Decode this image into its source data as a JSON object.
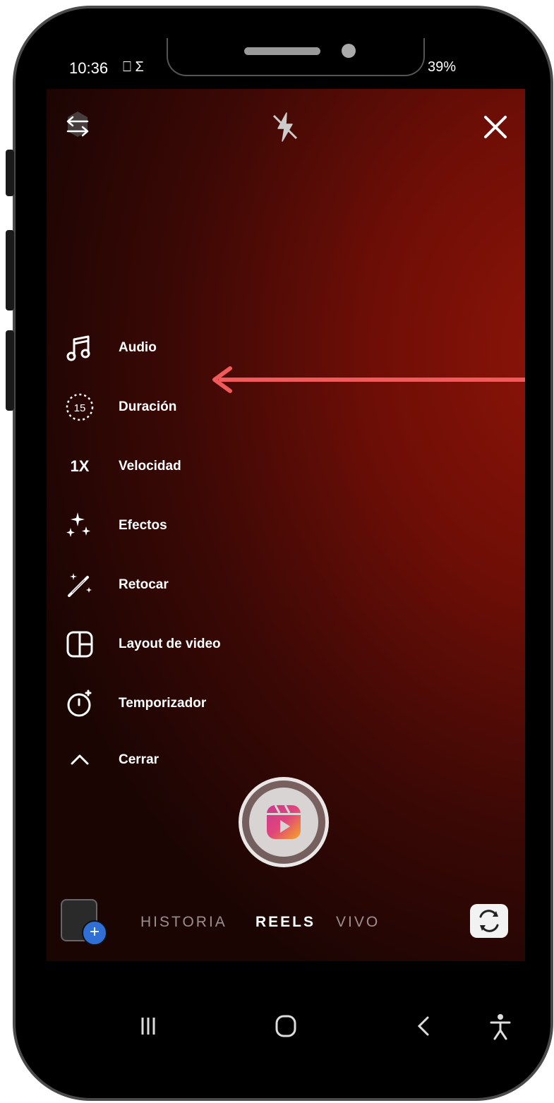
{
  "status_bar": {
    "time": "10:36",
    "left_icons": "⎕ Σ",
    "battery": "39%"
  },
  "menu": {
    "items": [
      {
        "label": "Audio",
        "icon": "music-note-icon"
      },
      {
        "label": "Duración",
        "icon": "timer-15-icon",
        "badge": "15"
      },
      {
        "label": "Velocidad",
        "icon": "speed-icon",
        "badge": "1X"
      },
      {
        "label": "Efectos",
        "icon": "sparkles-icon"
      },
      {
        "label": "Retocar",
        "icon": "magic-wand-icon"
      },
      {
        "label": "Layout de video",
        "icon": "layout-grid-icon"
      },
      {
        "label": "Temporizador",
        "icon": "stopwatch-icon"
      },
      {
        "label": "Cerrar",
        "icon": "chevron-up-icon"
      }
    ]
  },
  "modes": {
    "historia": "HISTORIA",
    "reels": "REELS",
    "vivo": "VIVO",
    "selected": "REELS"
  },
  "gallery_plus": "+",
  "colors": {
    "annotation_arrow": "#f05a5a",
    "background_red": "#8e1409",
    "shutter_gradient_start": "#e0457b",
    "shutter_gradient_end": "#f5a623"
  }
}
